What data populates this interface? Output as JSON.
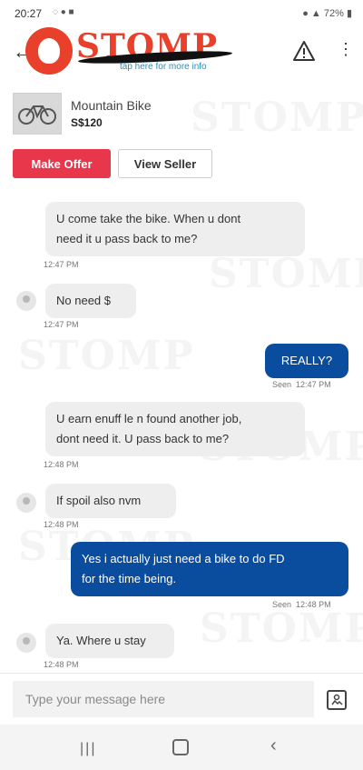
{
  "status_bar": {
    "time": "20:27",
    "battery": "72%"
  },
  "header": {
    "back_icon": "arrow-left-icon",
    "logo_text": "STOMP",
    "logo_tagline": "tap here for more info"
  },
  "product": {
    "name": "Mountain Bike",
    "price": "S$120"
  },
  "actions": {
    "make_offer": "Make Offer",
    "view_seller": "View Seller"
  },
  "watermark": "STOMP",
  "messages": [
    {
      "side": "in",
      "lines": [
        "U come take the bike. When u dont",
        "need it u pass back to me?"
      ],
      "time": "12:47 PM",
      "avatar": false
    },
    {
      "side": "in",
      "lines": [
        "No need $"
      ],
      "time": "12:47 PM",
      "avatar": true
    },
    {
      "side": "out",
      "lines": [
        "REALLY?"
      ],
      "time": "12:47 PM",
      "seen": "Seen"
    },
    {
      "side": "in",
      "lines": [
        "U earn enuff le n found another job,",
        "dont need it. U pass back to me?"
      ],
      "time": "12:48 PM",
      "avatar": false
    },
    {
      "side": "in",
      "lines": [
        "If spoil also nvm"
      ],
      "time": "12:48 PM",
      "avatar": true
    },
    {
      "side": "out",
      "lines": [
        "Yes i actually just need a bike to do FD",
        "for the time being."
      ],
      "time": "12:48 PM",
      "seen": "Seen"
    },
    {
      "side": "in",
      "lines": [
        "Ya. Where u stay"
      ],
      "time": "12:48 PM",
      "avatar": true
    }
  ],
  "composer": {
    "placeholder": "Type your message here"
  },
  "colors": {
    "accent_red": "#e8374a",
    "bubble_out": "#0a4d9f",
    "bubble_in": "#eeeeee"
  }
}
